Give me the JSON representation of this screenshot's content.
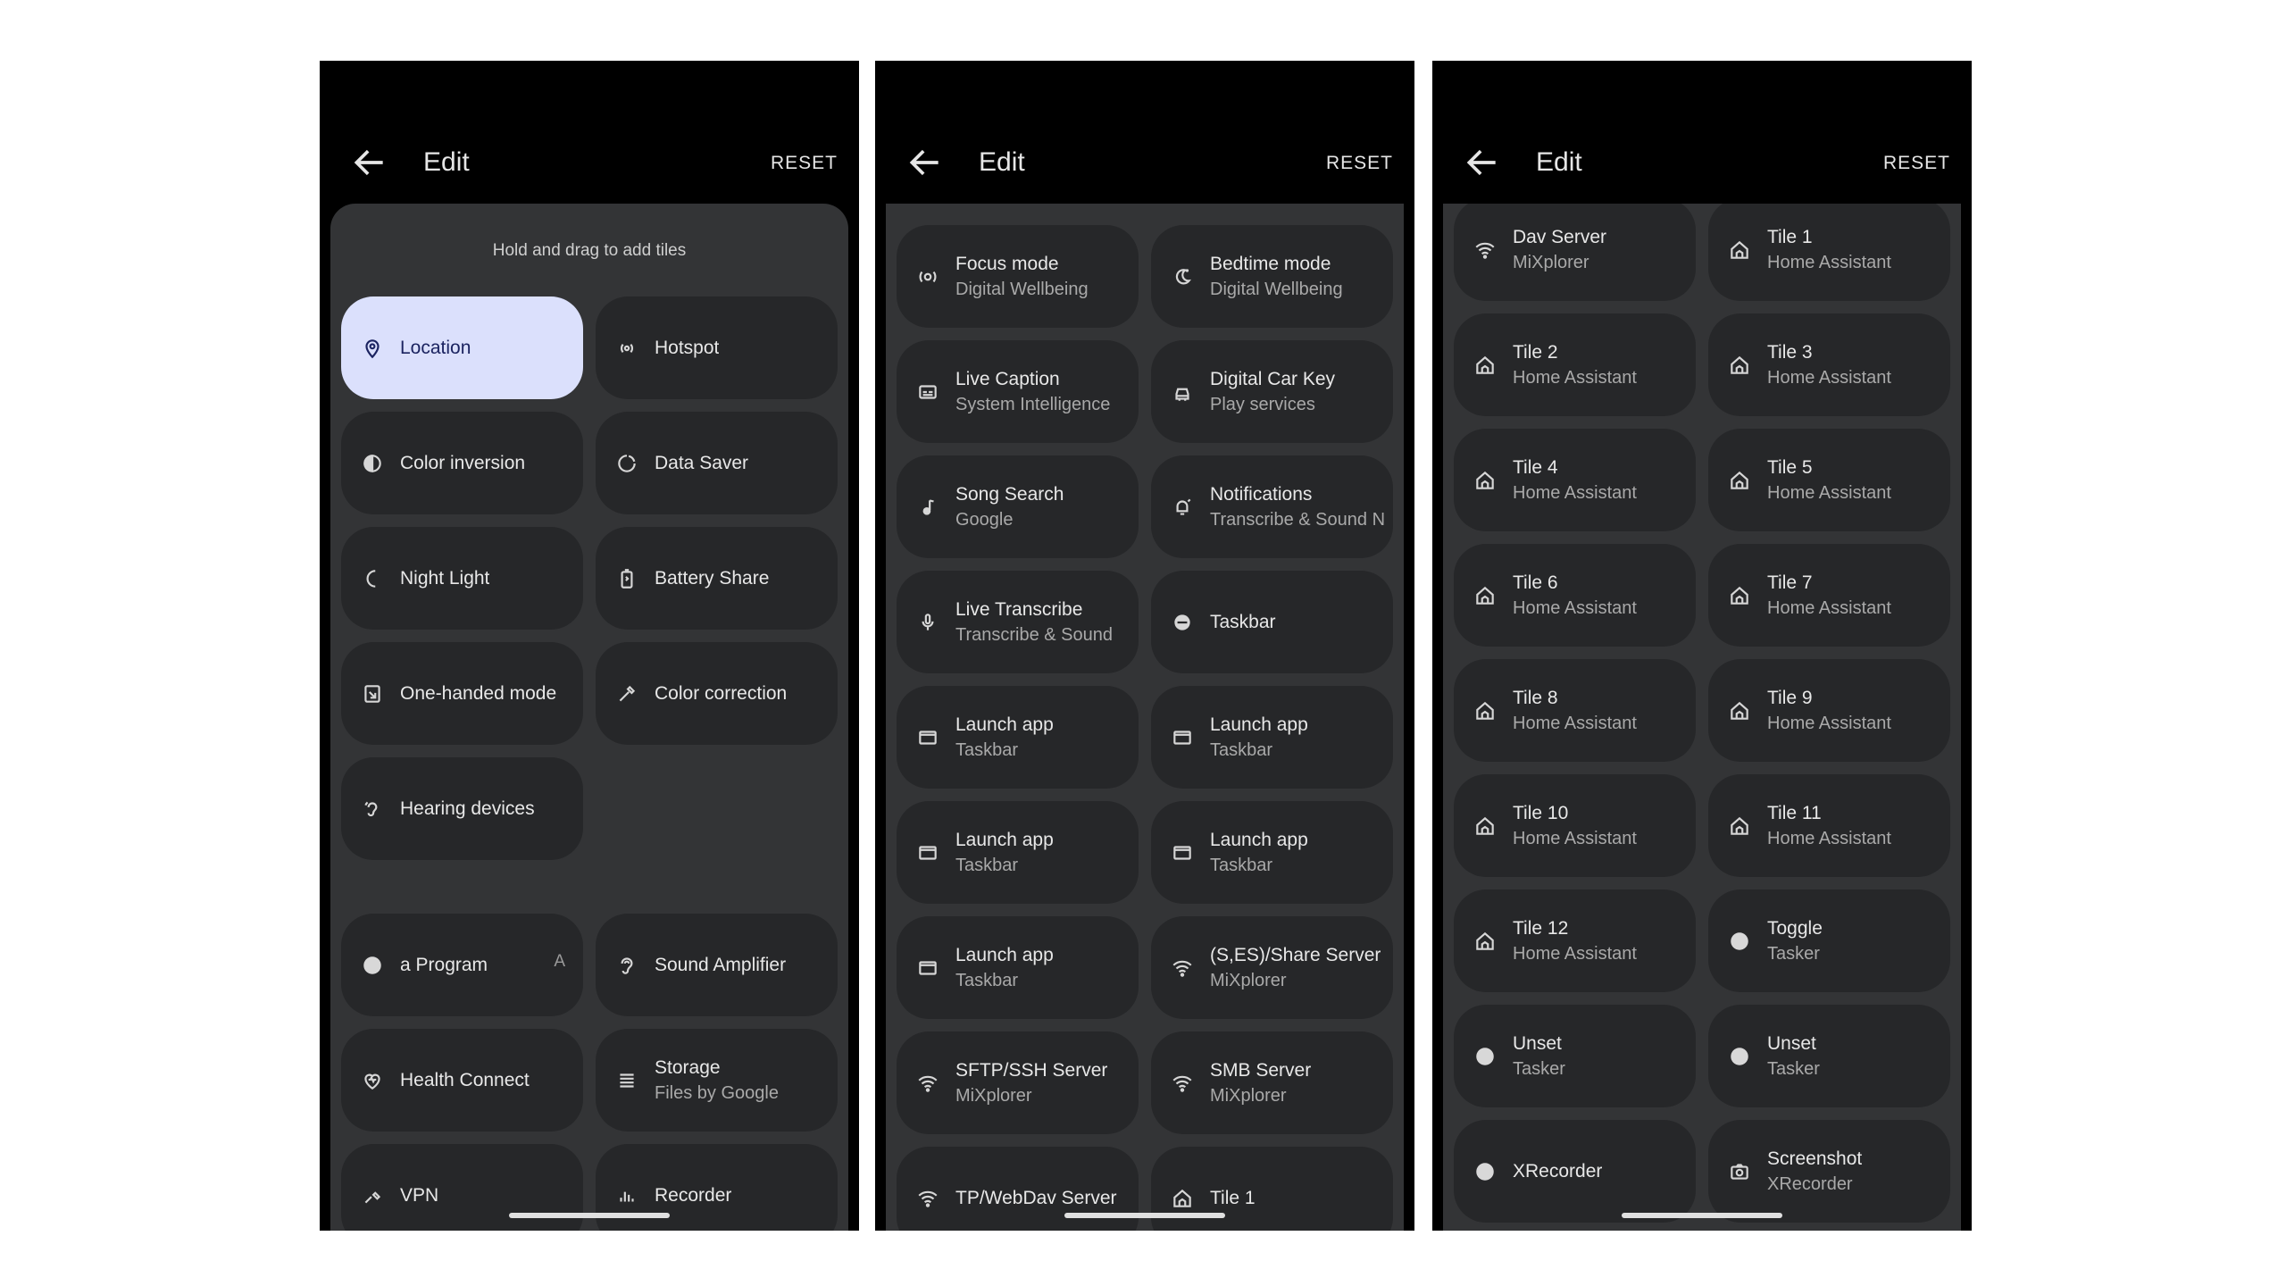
{
  "phones": [
    {
      "title": "Edit",
      "reset": "RESET",
      "hint": "Hold and drag to add tiles",
      "active_rows": [
        [
          {
            "label": "Location",
            "icon": "location-pin-icon",
            "active": true
          },
          {
            "label": "Hotspot",
            "icon": "hotspot-icon"
          }
        ],
        [
          {
            "label": "Color inversion",
            "icon": "color-inversion-icon"
          },
          {
            "label": "Data Saver",
            "icon": "data-saver-icon"
          }
        ],
        [
          {
            "label": "Night Light",
            "icon": "night-light-icon"
          },
          {
            "label": "Battery Share",
            "icon": "battery-share-icon"
          }
        ],
        [
          {
            "label": "One-handed mode",
            "icon": "one-handed-icon"
          },
          {
            "label": "Color correction",
            "icon": "color-correction-icon"
          }
        ],
        [
          {
            "label": "Hearing devices",
            "icon": "hearing-icon"
          }
        ]
      ],
      "available_rows": [
        [
          {
            "label": "a Program",
            "icon": "circle-icon",
            "trail": "A"
          },
          {
            "label": "Sound Amplifier",
            "icon": "ear-icon"
          }
        ],
        [
          {
            "label": "Health Connect",
            "icon": "heart-icon"
          },
          {
            "label": "Storage",
            "sub": "Files by Google",
            "icon": "storage-icon"
          }
        ],
        [
          {
            "label": "VPN",
            "icon": "vpn-icon"
          },
          {
            "label": "Recorder",
            "icon": "recorder-icon"
          }
        ]
      ]
    },
    {
      "title": "Edit",
      "reset": "RESET",
      "rows": [
        [
          {
            "label": "Focus mode",
            "sub": "Digital Wellbeing",
            "icon": "focus-icon"
          },
          {
            "label": "Bedtime mode",
            "sub": "Digital Wellbeing",
            "icon": "bedtime-icon"
          }
        ],
        [
          {
            "label": "Live Caption",
            "sub": "System Intelligence",
            "icon": "caption-icon"
          },
          {
            "label": "Digital Car Key",
            "sub": "Play services",
            "icon": "car-key-icon"
          }
        ],
        [
          {
            "label": "Song Search",
            "sub": "Google",
            "icon": "music-note-icon"
          },
          {
            "label": "Notifications",
            "sub": "Transcribe & Sound N",
            "icon": "notification-icon"
          }
        ],
        [
          {
            "label": "Live Transcribe",
            "sub": "Transcribe & Sound",
            "icon": "transcribe-icon"
          },
          {
            "label": "Taskbar",
            "icon": "taskbar-icon"
          }
        ],
        [
          {
            "label": "Launch app",
            "sub": "Taskbar",
            "icon": "window-icon"
          },
          {
            "label": "Launch app",
            "sub": "Taskbar",
            "icon": "window-icon"
          }
        ],
        [
          {
            "label": "Launch app",
            "sub": "Taskbar",
            "icon": "window-icon"
          },
          {
            "label": "Launch app",
            "sub": "Taskbar",
            "icon": "window-icon"
          }
        ],
        [
          {
            "label": "Launch app",
            "sub": "Taskbar",
            "icon": "window-icon"
          },
          {
            "label": "(S,ES)/Share Server",
            "sub": "MiXplorer",
            "icon": "wifi-icon"
          }
        ],
        [
          {
            "label": "SFTP/SSH Server",
            "sub": "MiXplorer",
            "icon": "wifi-icon"
          },
          {
            "label": "SMB Server",
            "sub": "MiXplorer",
            "icon": "wifi-icon"
          }
        ],
        [
          {
            "label": "TP/WebDav Server",
            "icon": "wifi-icon"
          },
          {
            "label": "Tile 1",
            "icon": "home-icon"
          }
        ]
      ]
    },
    {
      "title": "Edit",
      "reset": "RESET",
      "rows": [
        [
          {
            "label": "Dav Server",
            "sub": "MiXplorer",
            "icon": "wifi-icon"
          },
          {
            "label": "Tile 1",
            "sub": "Home Assistant",
            "icon": "home-icon"
          }
        ],
        [
          {
            "label": "Tile 2",
            "sub": "Home Assistant",
            "icon": "home-icon"
          },
          {
            "label": "Tile 3",
            "sub": "Home Assistant",
            "icon": "home-icon"
          }
        ],
        [
          {
            "label": "Tile 4",
            "sub": "Home Assistant",
            "icon": "home-icon"
          },
          {
            "label": "Tile 5",
            "sub": "Home Assistant",
            "icon": "home-icon"
          }
        ],
        [
          {
            "label": "Tile 6",
            "sub": "Home Assistant",
            "icon": "home-icon"
          },
          {
            "label": "Tile 7",
            "sub": "Home Assistant",
            "icon": "home-icon"
          }
        ],
        [
          {
            "label": "Tile 8",
            "sub": "Home Assistant",
            "icon": "home-icon"
          },
          {
            "label": "Tile 9",
            "sub": "Home Assistant",
            "icon": "home-icon"
          }
        ],
        [
          {
            "label": "Tile 10",
            "sub": "Home Assistant",
            "icon": "home-icon"
          },
          {
            "label": "Tile 11",
            "sub": "Home Assistant",
            "icon": "home-icon"
          }
        ],
        [
          {
            "label": "Tile 12",
            "sub": "Home Assistant",
            "icon": "home-icon"
          },
          {
            "label": "Toggle",
            "sub": "Tasker",
            "icon": "circle-icon"
          }
        ],
        [
          {
            "label": "Unset",
            "sub": "Tasker",
            "icon": "circle-icon"
          },
          {
            "label": "Unset",
            "sub": "Tasker",
            "icon": "circle-icon"
          }
        ],
        [
          {
            "label": "XRecorder",
            "icon": "circle-icon"
          },
          {
            "label": "Screenshot",
            "sub": "XRecorder",
            "icon": "camera-icon"
          }
        ]
      ]
    }
  ]
}
